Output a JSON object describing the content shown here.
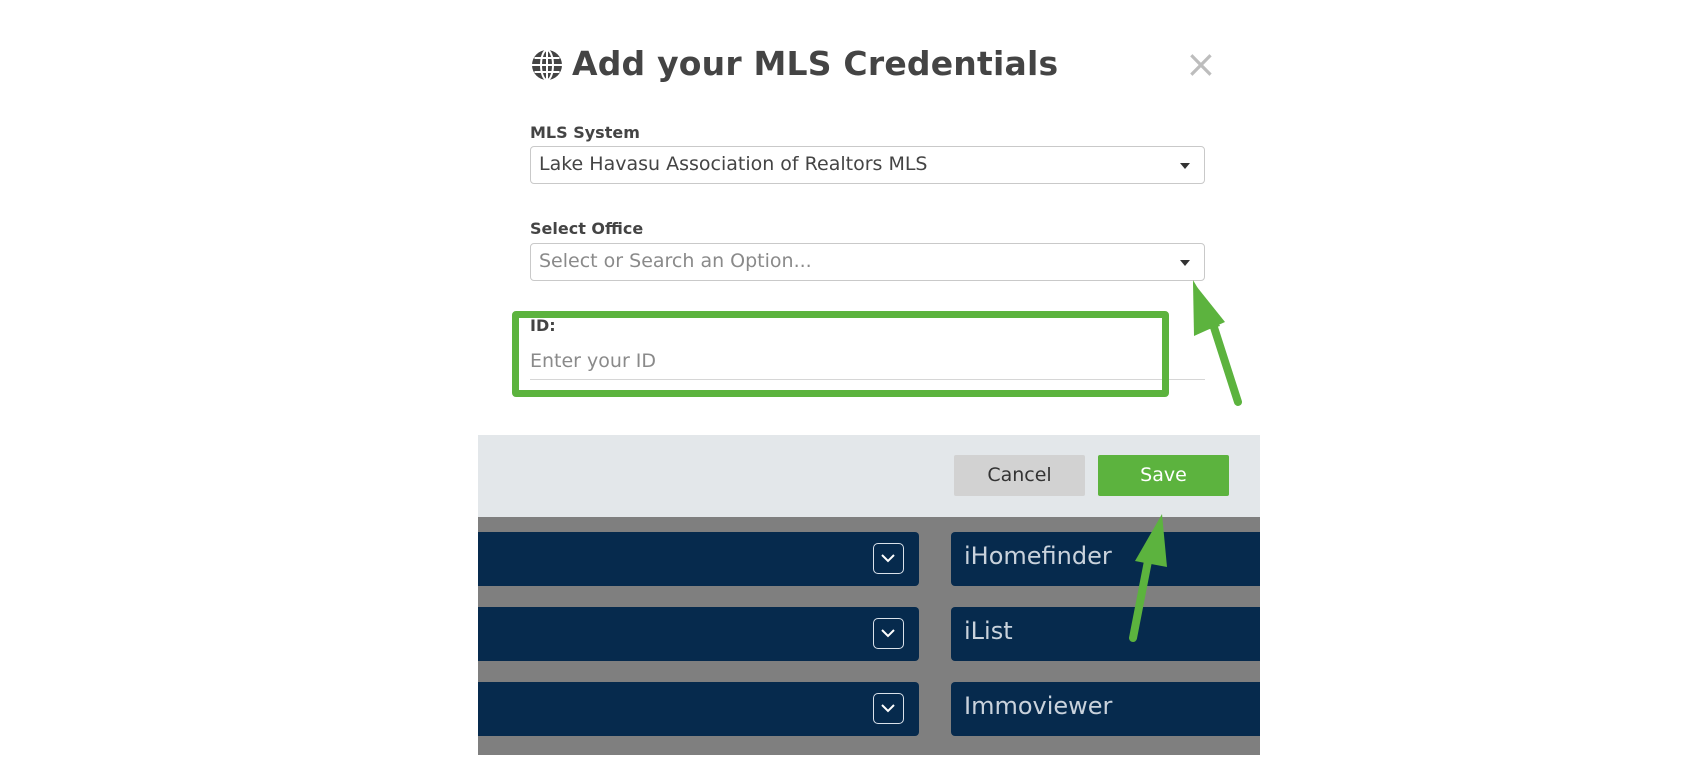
{
  "modal": {
    "title": "Add your MLS Credentials",
    "close_symbol": "×",
    "icon": "globe-icon"
  },
  "fields": {
    "mls_system": {
      "label": "MLS System",
      "value": "Lake Havasu Association of Realtors MLS"
    },
    "select_office": {
      "label": "Select Office",
      "placeholder": "Select or Search an Option..."
    },
    "id": {
      "label": "ID:",
      "placeholder": "Enter your ID",
      "value": ""
    }
  },
  "footer": {
    "cancel_label": "Cancel",
    "save_label": "Save"
  },
  "background_list": {
    "vendors": [
      "iHomefinder",
      "iList",
      "Immoviewer"
    ]
  },
  "colors": {
    "accent_green": "#5cb33e",
    "navy": "#062a4d",
    "footer_bg": "#e3e7ea",
    "backdrop_gray": "#7f7f7f"
  }
}
